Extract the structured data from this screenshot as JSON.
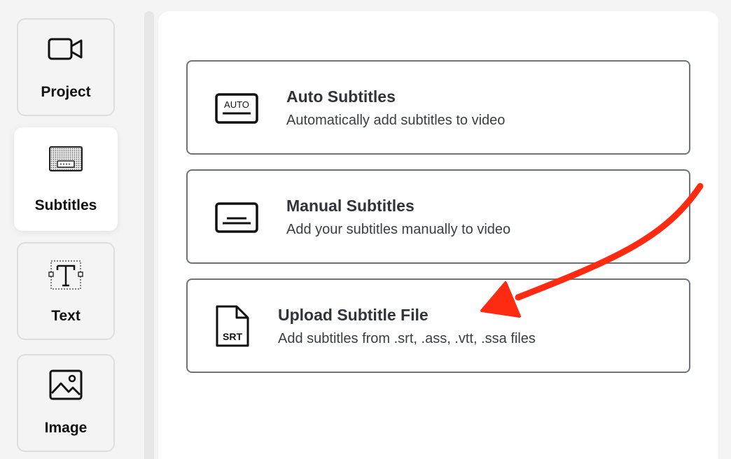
{
  "sidebar": {
    "items": [
      {
        "label": "Project",
        "icon": "video-camera-icon",
        "active": false
      },
      {
        "label": "Subtitles",
        "icon": "subtitles-icon",
        "active": true
      },
      {
        "label": "Text",
        "icon": "text-icon",
        "active": false
      },
      {
        "label": "Image",
        "icon": "image-icon",
        "active": false
      }
    ]
  },
  "options": [
    {
      "title": "Auto Subtitles",
      "description": "Automatically add subtitles to video",
      "icon": "auto-subtitles-icon",
      "icon_text": "AUTO"
    },
    {
      "title": "Manual Subtitles",
      "description": "Add your subtitles manually to video",
      "icon": "manual-subtitles-icon"
    },
    {
      "title": "Upload Subtitle File",
      "description": "Add subtitles from .srt, .ass, .vtt, .ssa files",
      "icon": "srt-file-icon",
      "icon_text": "SRT"
    }
  ],
  "annotation": {
    "arrow_color": "#ff2a12",
    "points_to": "Upload Subtitle File"
  },
  "colors": {
    "card_border": "#6f7277",
    "title_text": "#30343a",
    "active_bg": "#ffffff",
    "page_bg": "#f4f4f4"
  }
}
